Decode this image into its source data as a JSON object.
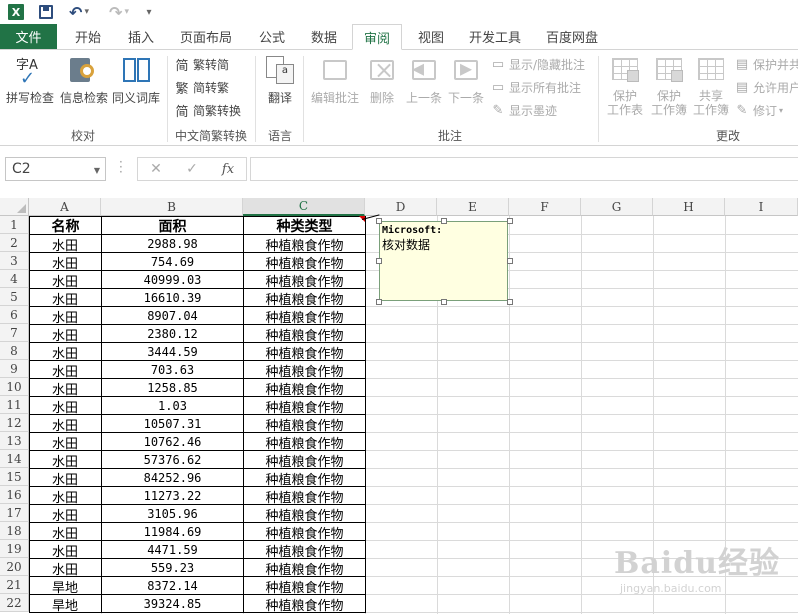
{
  "quick_access": {
    "undo": "↶",
    "redo": "↷",
    "more": "▾"
  },
  "tabs": {
    "file": "文件",
    "items": [
      "开始",
      "插入",
      "页面布局",
      "公式",
      "数据",
      "审阅",
      "视图",
      "开发工具",
      "百度网盘"
    ],
    "active": "审阅"
  },
  "ribbon": {
    "proofing": {
      "spell": "拼写检查",
      "research": "信息检索",
      "thesaurus": "同义词库",
      "group": "校对"
    },
    "chinese": {
      "to_simplified": "繁转简",
      "to_traditional": "简转繁",
      "convert": "简繁转换",
      "group": "中文简繁转换",
      "glyph_fan": "繁",
      "glyph_jian": "简"
    },
    "language": {
      "translate": "翻译",
      "group": "语言",
      "icon_text": "a"
    },
    "comments": {
      "edit": "编辑批注",
      "delete": "删除",
      "prev": "上一条",
      "next": "下一条",
      "show_hide": "显示/隐藏批注",
      "show_all": "显示所有批注",
      "show_ink": "显示墨迹",
      "group": "批注"
    },
    "changes": {
      "protect_sheet_1": "保护",
      "protect_sheet_2": "工作表",
      "protect_wb_1": "保护",
      "protect_wb_2": "工作簿",
      "share_wb_1": "共享",
      "share_wb_2": "工作簿",
      "protect_share": "保护并共",
      "allow_users": "允许用户",
      "track": "修订",
      "group": "更改"
    }
  },
  "formula_bar": {
    "name_box": "C2",
    "cancel": "✕",
    "enter": "✓",
    "fx": "fx",
    "value": ""
  },
  "sheet": {
    "columns": [
      "A",
      "B",
      "C",
      "D",
      "E",
      "F",
      "G",
      "H",
      "I"
    ],
    "row_numbers": [
      "1",
      "2",
      "3",
      "4",
      "5",
      "6",
      "7",
      "8",
      "9",
      "10",
      "11",
      "12",
      "13",
      "14",
      "15",
      "16",
      "17",
      "18",
      "19",
      "20",
      "21",
      "22"
    ],
    "header": [
      "名称",
      "面积",
      "种类类型"
    ],
    "rows": [
      [
        "水田",
        "2988.98",
        "种植粮食作物"
      ],
      [
        "水田",
        "754.69",
        "种植粮食作物"
      ],
      [
        "水田",
        "40999.03",
        "种植粮食作物"
      ],
      [
        "水田",
        "16610.39",
        "种植粮食作物"
      ],
      [
        "水田",
        "8907.04",
        "种植粮食作物"
      ],
      [
        "水田",
        "2380.12",
        "种植粮食作物"
      ],
      [
        "水田",
        "3444.59",
        "种植粮食作物"
      ],
      [
        "水田",
        "703.63",
        "种植粮食作物"
      ],
      [
        "水田",
        "1258.85",
        "种植粮食作物"
      ],
      [
        "水田",
        "1.03",
        "种植粮食作物"
      ],
      [
        "水田",
        "10507.31",
        "种植粮食作物"
      ],
      [
        "水田",
        "10762.46",
        "种植粮食作物"
      ],
      [
        "水田",
        "57376.62",
        "种植粮食作物"
      ],
      [
        "水田",
        "84252.96",
        "种植粮食作物"
      ],
      [
        "水田",
        "11273.22",
        "种植粮食作物"
      ],
      [
        "水田",
        "3105.96",
        "种植粮食作物"
      ],
      [
        "水田",
        "11984.69",
        "种植粮食作物"
      ],
      [
        "水田",
        "4471.59",
        "种植粮食作物"
      ],
      [
        "水田",
        "559.23",
        "种植粮食作物"
      ],
      [
        "旱地",
        "8372.14",
        "种植粮食作物"
      ],
      [
        "旱地",
        "39324.85",
        "种植粮食作物"
      ]
    ]
  },
  "comment": {
    "author": "Microsoft:",
    "text": "核对数据"
  },
  "watermark": {
    "main": "Baidu经验",
    "url": "jingyan.baidu.com"
  },
  "colors": {
    "accent": "#217346",
    "comment_bg": "#ffffe1"
  }
}
